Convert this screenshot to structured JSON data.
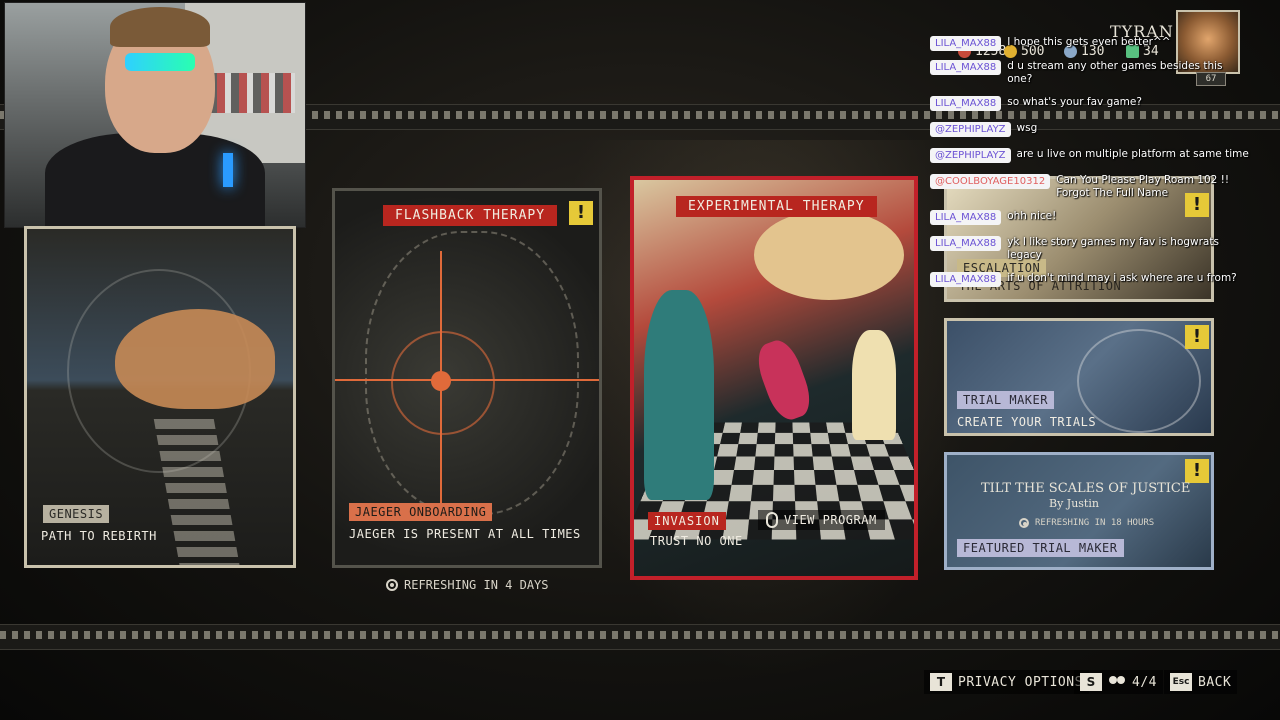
{
  "streamer": {
    "name": "TYRAN",
    "level": "67",
    "currencies": [
      {
        "icon": "bloodpoints-icon",
        "value": "1258",
        "color": "#c84a3a"
      },
      {
        "icon": "gold-coin-icon",
        "value": "500",
        "color": "#e0b030"
      },
      {
        "icon": "shards-icon",
        "value": "130",
        "color": "#8aa8c8"
      },
      {
        "icon": "cells-icon",
        "value": "34",
        "color": "#58c080"
      }
    ]
  },
  "chat": [
    {
      "user": "LILA_MAX88",
      "msg": "I hope this gets even better^^",
      "color": "purple"
    },
    {
      "user": "LILA_MAX88",
      "msg": "d u stream any other games besides this one?",
      "color": "purple"
    },
    {
      "user": "LILA_MAX88",
      "msg": "so what's your fav game?",
      "color": "purple"
    },
    {
      "user": "@ZEPHIPLAYZ",
      "msg": "wsg",
      "color": "purple"
    },
    {
      "user": "@ZEPHIPLAYZ",
      "msg": "are u live on multiple platform at same time",
      "color": "purple"
    },
    {
      "user": "@COOLBOYAGE10312",
      "msg": "Can You Please Play Roam 102 !! Forgot The Full Name",
      "color": "coral"
    },
    {
      "user": "LILA_MAX88",
      "msg": "ohh nice!",
      "color": "purple"
    },
    {
      "user": "LILA_MAX88",
      "msg": "yk I like story games my fav is hogwrats legacy",
      "color": "purple"
    },
    {
      "user": "LILA_MAX88",
      "msg": "if u don't mind may i ask where are u from?",
      "color": "purple"
    }
  ],
  "cards": {
    "genesis": {
      "tag": "GENESIS",
      "subtitle": "PATH TO REBIRTH"
    },
    "flashback": {
      "title": "FLASHBACK THERAPY",
      "tag": "JAEGER ONBOARDING",
      "subtitle": "JAEGER IS PRESENT AT ALL TIMES",
      "alert": "!"
    },
    "experimental": {
      "title": "EXPERIMENTAL THERAPY",
      "tag": "INVASION",
      "subtitle": "TRUST NO ONE",
      "view_program": "VIEW PROGRAM"
    },
    "refresh_text": "REFRESHING IN 4 DAYS"
  },
  "side_cards": {
    "attrition": {
      "tag": "ESCALATION",
      "subtitle": "THE ARTS OF ATTRITION",
      "alert": "!"
    },
    "trial_maker": {
      "tag": "TRIAL MAKER",
      "subtitle": "CREATE YOUR TRIALS",
      "alert": "!"
    },
    "featured": {
      "title": "TILT THE SCALES OF JUSTICE",
      "author": "By Justin",
      "refresh": "REFRESHING IN 18 HOURS",
      "tag": "FEATURED TRIAL MAKER",
      "alert": "!"
    }
  },
  "bottom_bar": {
    "privacy_key": "T",
    "privacy_label": "PRIVACY OPTIONS",
    "party_key": "S",
    "party_count": "4/4",
    "back_key": "Esc",
    "back_label": "BACK"
  }
}
